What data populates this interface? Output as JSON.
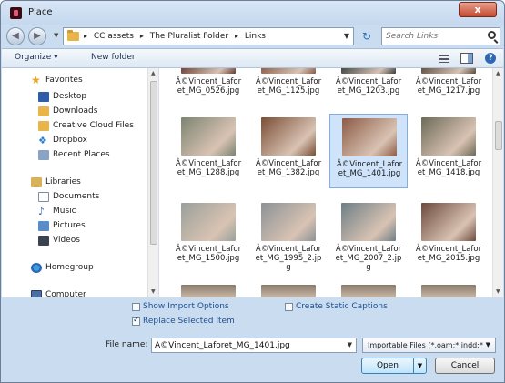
{
  "window": {
    "title": "Place",
    "close_symbol": "x"
  },
  "address": {
    "crumbs": [
      "CC assets",
      "The Pluralist Folder",
      "Links"
    ],
    "search_placeholder": "Search Links"
  },
  "toolbar": {
    "organize": "Organize ▾",
    "new_folder": "New folder"
  },
  "nav": {
    "favorites": "Favorites",
    "favorites_items": [
      "Desktop",
      "Downloads",
      "Creative Cloud Files",
      "Dropbox",
      "Recent Places"
    ],
    "libraries": "Libraries",
    "libraries_items": [
      "Documents",
      "Music",
      "Pictures",
      "Videos"
    ],
    "homegroup": "Homegroup",
    "computer": "Computer"
  },
  "files": [
    {
      "name": "Â©Vincent_Lafor\net_MG_0526.jpg",
      "color": "#6a3a2e",
      "selected": false
    },
    {
      "name": "Â©Vincent_Lafor\net_MG_1125.jpg",
      "color": "#8a5a44",
      "selected": false
    },
    {
      "name": "Â©Vincent_Lafor\net_MG_1203.jpg",
      "color": "#3a3e3c",
      "selected": false
    },
    {
      "name": "Â©Vincent_Lafor\net_MG_1217.jpg",
      "color": "#5a4a3a",
      "selected": false
    },
    {
      "name": "Â©Vincent_Lafor\net_MG_1288.jpg",
      "color": "#7d8472",
      "selected": false
    },
    {
      "name": "Â©Vincent_Lafor\net_MG_1382.jpg",
      "color": "#7a4e36",
      "selected": false
    },
    {
      "name": "Â©Vincent_Lafor\net_MG_1401.jpg",
      "color": "#8c5b46",
      "selected": true
    },
    {
      "name": "Â©Vincent_Lafor\net_MG_1418.jpg",
      "color": "#6d6a58",
      "selected": false
    },
    {
      "name": "Â©Vincent_Lafor\net_MG_1500.jpg",
      "color": "#9aa09a",
      "selected": false
    },
    {
      "name": "Â©Vincent_Lafor\net_MG_1995_2.jp\ng",
      "color": "#8b9296",
      "selected": false
    },
    {
      "name": "Â©Vincent_Lafor\net_MG_2007_2.jp\ng",
      "color": "#6e7f86",
      "selected": false
    },
    {
      "name": "Â©Vincent_Lafor\net_MG_2015.jpg",
      "color": "#6d4a3c",
      "selected": false
    }
  ],
  "options": {
    "show_import": "Show Import Options",
    "create_static": "Create Static Captions",
    "replace_selected": "Replace Selected Item",
    "replace_checked": true
  },
  "footer": {
    "file_name_label": "File name:",
    "file_name_value": "Â©Vincent_Laforet_MG_1401.jpg",
    "file_type": "Importable Files (*.oam;*.indd;*",
    "open": "Open",
    "cancel": "Cancel"
  }
}
